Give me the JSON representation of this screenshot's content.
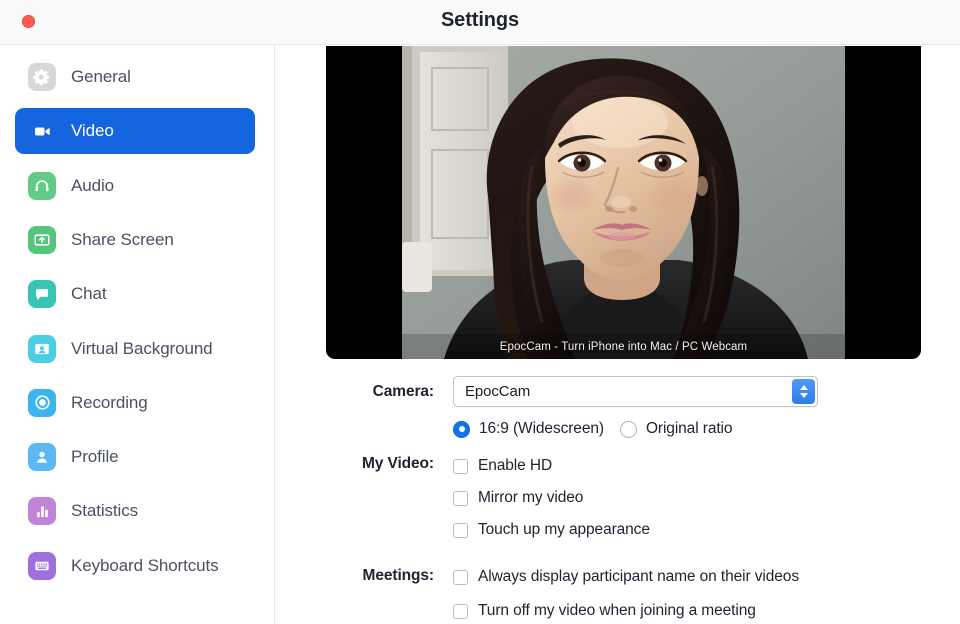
{
  "window": {
    "title": "Settings",
    "close_button": "close-button"
  },
  "colors": {
    "accent": "#1565e0",
    "close": "#fc5b53",
    "selected_text": "#ffffff",
    "label_text": "#4b5162"
  },
  "sidebar": {
    "items": [
      {
        "label": "General",
        "icon": "gear-icon",
        "icon_color": "#d8d8d8",
        "selected": false
      },
      {
        "label": "Video",
        "icon": "video-camera-icon",
        "icon_color": "#1565e0",
        "selected": true
      },
      {
        "label": "Audio",
        "icon": "headphones-icon",
        "icon_color": "#63cb85",
        "selected": false
      },
      {
        "label": "Share Screen",
        "icon": "share-screen-icon",
        "icon_color": "#55c47c",
        "selected": false
      },
      {
        "label": "Chat",
        "icon": "chat-bubble-icon",
        "icon_color": "#3bc4b4",
        "selected": false
      },
      {
        "label": "Virtual Background",
        "icon": "virtual-background-icon",
        "icon_color": "#4bcde2",
        "selected": false
      },
      {
        "label": "Recording",
        "icon": "record-circle-icon",
        "icon_color": "#3bb4ef",
        "selected": false
      },
      {
        "label": "Profile",
        "icon": "person-icon",
        "icon_color": "#5cb8f2",
        "selected": false
      },
      {
        "label": "Statistics",
        "icon": "bar-chart-icon",
        "icon_color": "#c084d8",
        "selected": false
      },
      {
        "label": "Keyboard Shortcuts",
        "icon": "keyboard-icon",
        "icon_color": "#9d70dd",
        "selected": false
      }
    ]
  },
  "video_preview": {
    "watermark": "EpocCam - Turn iPhone into Mac / PC Webcam"
  },
  "form": {
    "camera": {
      "label": "Camera:",
      "selected_value": "EpocCam",
      "options": [
        "EpocCam"
      ]
    },
    "aspect_ratio": {
      "options": [
        {
          "label": "16:9 (Widescreen)",
          "selected": true
        },
        {
          "label": "Original ratio",
          "selected": false
        }
      ]
    },
    "my_video": {
      "label": "My Video:",
      "checkboxes": [
        {
          "label": "Enable HD",
          "checked": false
        },
        {
          "label": "Mirror my video",
          "checked": false
        },
        {
          "label": "Touch up my appearance",
          "checked": false
        }
      ]
    },
    "meetings": {
      "label": "Meetings:",
      "checkboxes": [
        {
          "label": "Always display participant name on their videos",
          "checked": false
        },
        {
          "label": "Turn off my video when joining a meeting",
          "checked": false
        }
      ]
    }
  }
}
